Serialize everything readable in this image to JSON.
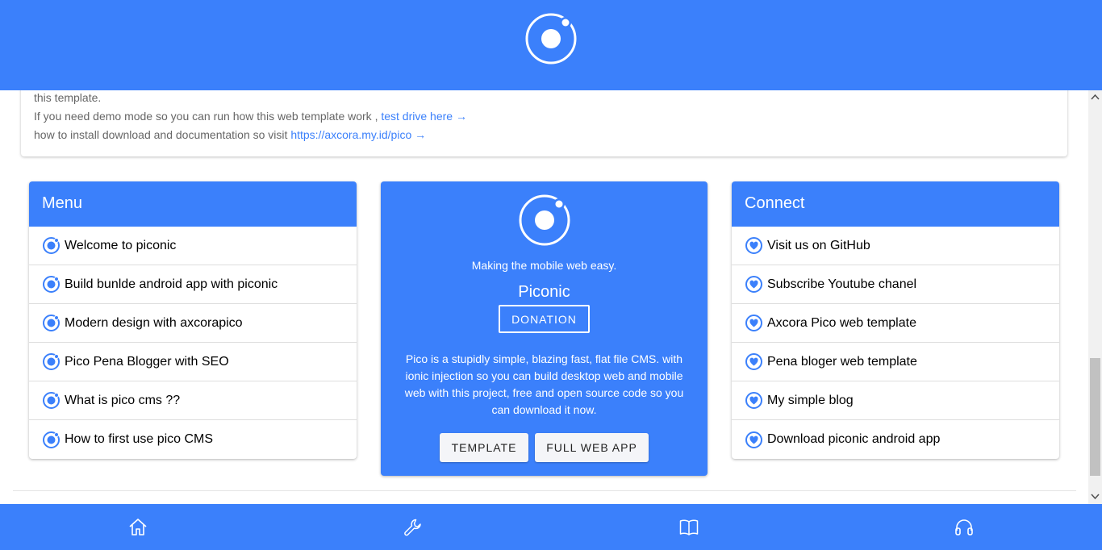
{
  "colors": {
    "primary": "#3b80fb",
    "white": "#ffffff",
    "muted_text": "#666666"
  },
  "header": {
    "logo_icon": "ionic-logo-icon"
  },
  "intro": {
    "line1": "this template.",
    "line2_text": "If you need demo mode so you can run how this web template work ,",
    "line2_link": "test drive here →",
    "line3_text": "how to install download and documentation so visit",
    "line3_link": "https://axcora.my.id/pico →"
  },
  "menu": {
    "title": "Menu",
    "icon": "ionic-icon",
    "items": [
      "Welcome to piconic",
      "Build bunlde android app with piconic",
      "Modern design with axcorapico",
      "Pico Pena Blogger with SEO",
      "What is pico cms ??",
      "How to first use pico CMS"
    ]
  },
  "promo": {
    "tagline": "Making the mobile web easy.",
    "name": "Piconic",
    "donate_label": "DONATION",
    "description": "Pico is a stupidly simple, blazing fast, flat file CMS. with ionic injection so you can build desktop web and mobile web with this project, free and open source code so you can download it now.",
    "template_label": "TEMPLATE",
    "webapp_label": "FULL WEB APP"
  },
  "connect": {
    "title": "Connect",
    "icon": "heart-circle-icon",
    "items": [
      "Visit us on GitHub",
      "Subscribe Youtube chanel",
      "Axcora Pico web template",
      "Pena bloger web template",
      "My simple blog",
      "Download piconic android app"
    ]
  },
  "footer": {
    "tabs": [
      "home-icon",
      "build-wrench-icon",
      "book-icon",
      "headset-icon"
    ]
  }
}
